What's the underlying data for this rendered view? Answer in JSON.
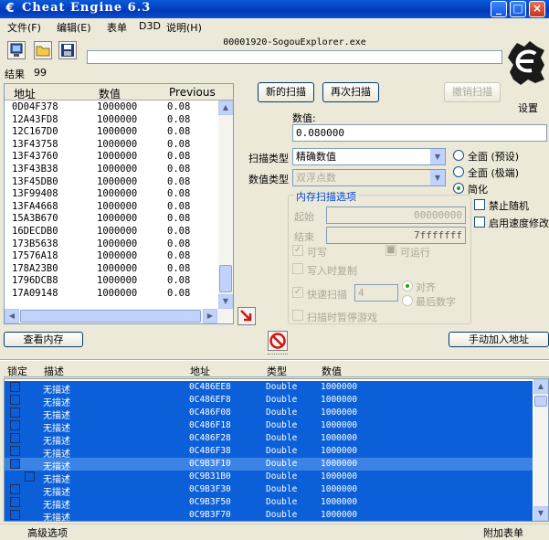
{
  "window": {
    "title": "Cheat Engine 6.3"
  },
  "menu": [
    "文件(F)",
    "编辑(E)",
    "表单",
    "D3D",
    "说明(H)"
  ],
  "process": {
    "title": "00001920-SogouExplorer.exe"
  },
  "results": {
    "label": "结果",
    "count": "99"
  },
  "settings_label": "设置",
  "found_list": {
    "columns": [
      "地址",
      "数值",
      "Previous"
    ],
    "rows": [
      {
        "address": "0D04F378",
        "value": "1000000",
        "previous": "0.08"
      },
      {
        "address": "12A43FD8",
        "value": "1000000",
        "previous": "0.08"
      },
      {
        "address": "12C167D0",
        "value": "1000000",
        "previous": "0.08"
      },
      {
        "address": "13F43758",
        "value": "1000000",
        "previous": "0.08"
      },
      {
        "address": "13F43760",
        "value": "1000000",
        "previous": "0.08"
      },
      {
        "address": "13F43B38",
        "value": "1000000",
        "previous": "0.08"
      },
      {
        "address": "13F45DB0",
        "value": "1000000",
        "previous": "0.08"
      },
      {
        "address": "13F99408",
        "value": "1000000",
        "previous": "0.08"
      },
      {
        "address": "13FA4668",
        "value": "1000000",
        "previous": "0.08"
      },
      {
        "address": "15A3B670",
        "value": "1000000",
        "previous": "0.08"
      },
      {
        "address": "16DECDB0",
        "value": "1000000",
        "previous": "0.08"
      },
      {
        "address": "173B5638",
        "value": "1000000",
        "previous": "0.08"
      },
      {
        "address": "17576A18",
        "value": "1000000",
        "previous": "0.08"
      },
      {
        "address": "178A23B0",
        "value": "1000000",
        "previous": "0.08"
      },
      {
        "address": "1796DCB8",
        "value": "1000000",
        "previous": "0.08"
      },
      {
        "address": "17A09148",
        "value": "1000000",
        "previous": "0.08"
      }
    ]
  },
  "buttons": {
    "new_scan": "新的扫描",
    "next_scan": "再次扫描",
    "undo_scan": "撤销扫描",
    "view_memory": "查看内存",
    "add_address": "手动加入地址"
  },
  "scan": {
    "value_label": "数值:",
    "value": "0.080000",
    "scan_type_label": "扫描类型",
    "scan_type": "精确数值",
    "value_type_label": "数值类型",
    "value_type": "双浮点数",
    "options_title": "内存扫描选项",
    "start_label": "起始",
    "start": "00000000",
    "stop_label": "结束",
    "stop": "7fffffff",
    "writable": "可写",
    "executable": "可运行",
    "copy_on_write": "写入时复制",
    "fast_scan": "快速扫描",
    "fast_scan_value": "4",
    "align": "对齐",
    "last_digits": "最后数字",
    "pause_game": "扫描时暂停游戏"
  },
  "radios": {
    "full": "全面 (预设)",
    "full_extreme": "全面 (极端)",
    "simple": "简化"
  },
  "checks": {
    "no_random": "禁止随机",
    "speedhack": "启用速度修改"
  },
  "address_table": {
    "columns": [
      "锁定",
      "描述",
      "地址",
      "类型",
      "数值"
    ],
    "rows": [
      {
        "desc": "无描述",
        "address": "0C486EE8",
        "type": "Double",
        "value": "1000000"
      },
      {
        "desc": "无描述",
        "address": "0C486EF8",
        "type": "Double",
        "value": "1000000"
      },
      {
        "desc": "无描述",
        "address": "0C486F08",
        "type": "Double",
        "value": "1000000"
      },
      {
        "desc": "无描述",
        "address": "0C486F18",
        "type": "Double",
        "value": "1000000"
      },
      {
        "desc": "无描述",
        "address": "0C486F28",
        "type": "Double",
        "value": "1000000"
      },
      {
        "desc": "无描述",
        "address": "0C486F38",
        "type": "Double",
        "value": "1000000"
      },
      {
        "desc": "无描述",
        "address": "0C9B3F10",
        "type": "Double",
        "value": "1000000"
      },
      {
        "desc": "无描述",
        "address": "0C9B31B0",
        "type": "Double",
        "value": "1000000"
      },
      {
        "desc": "无描述",
        "address": "0C9B3F30",
        "type": "Double",
        "value": "1000000"
      },
      {
        "desc": "无描述",
        "address": "0C9B3F50",
        "type": "Double",
        "value": "1000000"
      },
      {
        "desc": "无描述",
        "address": "0C9B3F70",
        "type": "Double",
        "value": "1000000"
      }
    ]
  },
  "status": {
    "advanced": "高级选项",
    "table_extras": "附加表单"
  }
}
